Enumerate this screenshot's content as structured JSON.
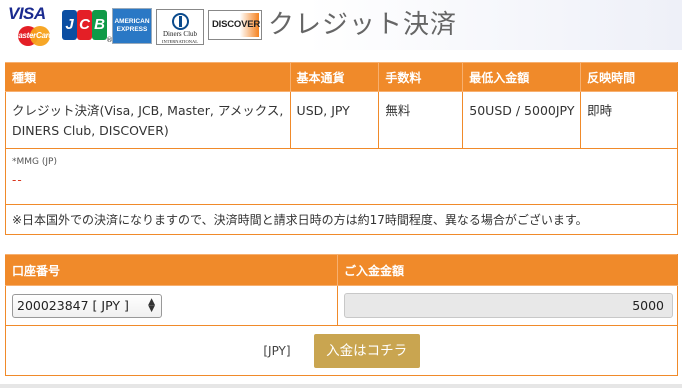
{
  "header": {
    "title": "クレジット決済",
    "logos": [
      {
        "icon": "visa-mastercard-logo",
        "text": "VISA",
        "subtext": "MasterCard"
      },
      {
        "icon": "jcb-logo",
        "text": "JCB",
        "mark": "®"
      },
      {
        "icon": "amex-logo",
        "text": "AMERICAN EXPRESS"
      },
      {
        "icon": "diners-club-logo",
        "text": "Diners Club",
        "subtext": "INTERNATIONAL"
      },
      {
        "icon": "discover-logo",
        "text": "DISCOVER"
      }
    ]
  },
  "info_table": {
    "headers": [
      "種類",
      "基本通貨",
      "手数料",
      "最低入金額",
      "反映時間"
    ],
    "row": {
      "type": "クレジット決済(Visa, JCB, Master, アメックス, DINERS Club, DISCOVER)",
      "currency": "USD, JPY",
      "fee": "無料",
      "minimum": "50USD / 5000JPY",
      "reflect_time": "即時"
    },
    "mmg": {
      "label": "*MMG (JP)",
      "value": "--"
    },
    "note": "※日本国外での決済になりますので、決済時間と請求日時の方は約17時間程度、異なる場合がございます。"
  },
  "deposit_form": {
    "headers": {
      "account": "口座番号",
      "amount": "ご入金金額"
    },
    "account_select": {
      "selected": "200023847 [ JPY ]"
    },
    "amount_input": {
      "value": "5000"
    },
    "currency_label": "[JPY]",
    "submit_label": "入金はコチラ"
  },
  "colors": {
    "accent": "#f08a2a",
    "button": "#c9a550",
    "title": "#666666",
    "mmg_value": "#d9371f"
  }
}
